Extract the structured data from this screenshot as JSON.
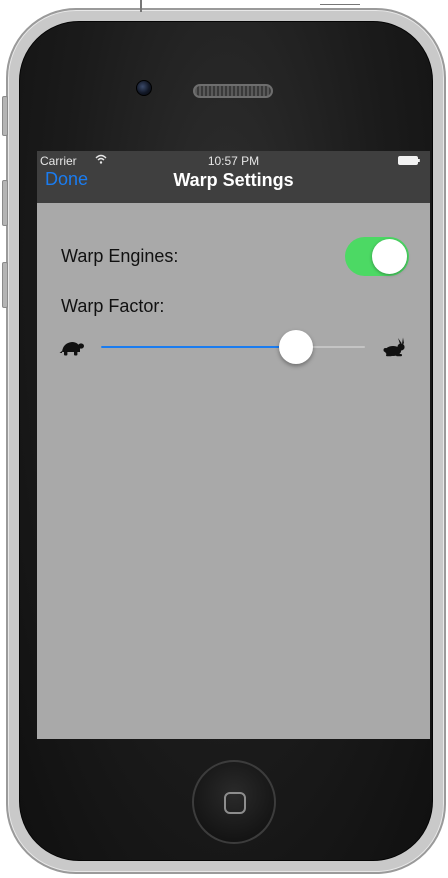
{
  "status_bar": {
    "carrier": "Carrier",
    "time": "10:57 PM"
  },
  "navbar": {
    "done_label": "Done",
    "title": "Warp Settings"
  },
  "settings": {
    "warp_engines_label": "Warp Engines:",
    "warp_engines_on": true,
    "warp_factor_label": "Warp Factor:",
    "warp_factor_value": 0.74,
    "min_icon": "turtle-icon",
    "max_icon": "rabbit-icon"
  },
  "colors": {
    "accent": "#1a7cf0",
    "toggle_on": "#4cd964",
    "navbar_bg": "#3f3f3f",
    "screen_bg": "#a9a9a9"
  }
}
